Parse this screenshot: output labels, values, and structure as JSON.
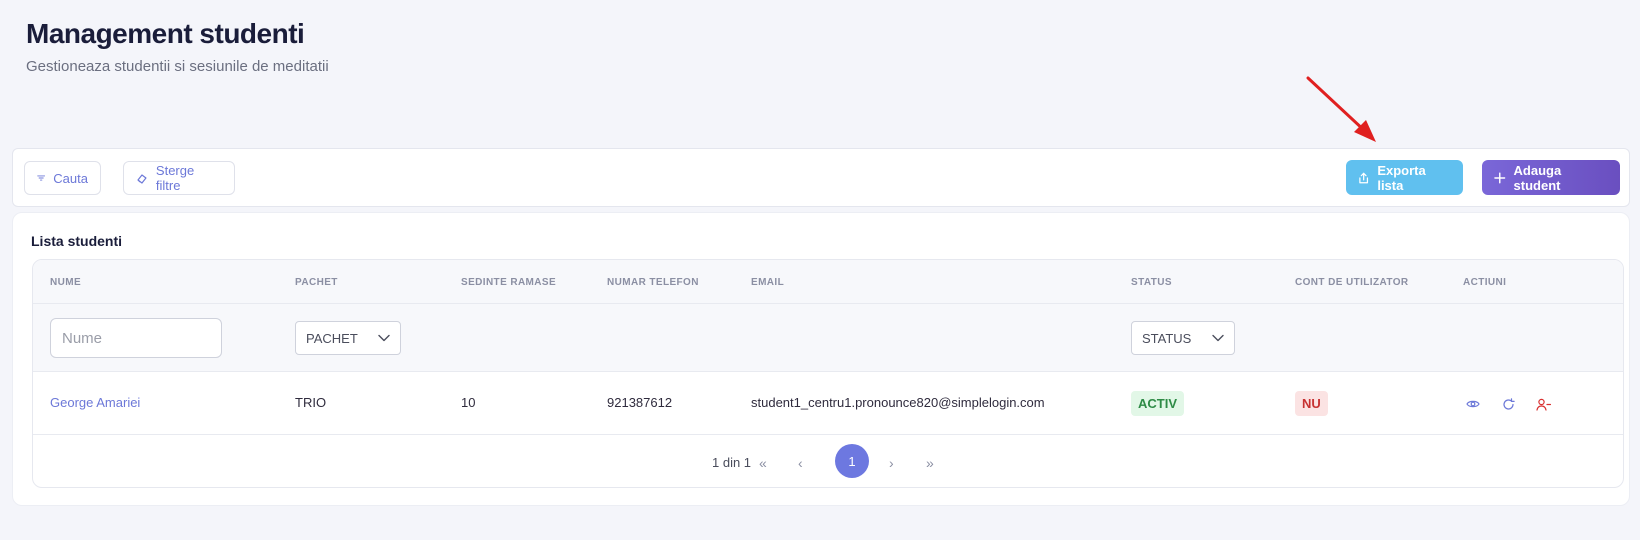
{
  "header": {
    "title": "Management studenti",
    "subtitle": "Gestioneaza studentii si sesiunile de meditatii"
  },
  "toolbar": {
    "search_label": "Cauta",
    "clear_filters_label": "Sterge filtre",
    "export_label": "Exporta lista",
    "add_label": "Adauga student"
  },
  "card": {
    "title": "Lista studenti"
  },
  "table": {
    "columns": [
      "NUME",
      "PACHET",
      "SEDINTE RAMASE",
      "NUMAR TELEFON",
      "EMAIL",
      "STATUS",
      "CONT DE UTILIZATOR",
      "ACTIUNI"
    ],
    "filters": {
      "name_placeholder": "Nume",
      "pachet_value": "PACHET",
      "status_value": "STATUS"
    },
    "rows": [
      {
        "name": "George Amariei",
        "pachet": "TRIO",
        "sedinte": "10",
        "telefon": "921387612",
        "email": "student1_centru1.pronounce820@simplelogin.com",
        "status": "ACTIV",
        "cont": "NU"
      }
    ]
  },
  "pagination": {
    "info": "1 din 1",
    "first": "«",
    "prev": "‹",
    "current": "1",
    "next": "›",
    "last": "»"
  },
  "colors": {
    "accent": "#6c78d8",
    "export": "#60c0ef",
    "add": "#6a4fc0",
    "arrow": "#e02020"
  },
  "icons": [
    "filter-icon",
    "eraser-icon",
    "export-icon",
    "plus-icon",
    "chevron-down-icon",
    "eye-icon",
    "refresh-icon",
    "remove-user-icon",
    "arrow-annotation"
  ]
}
